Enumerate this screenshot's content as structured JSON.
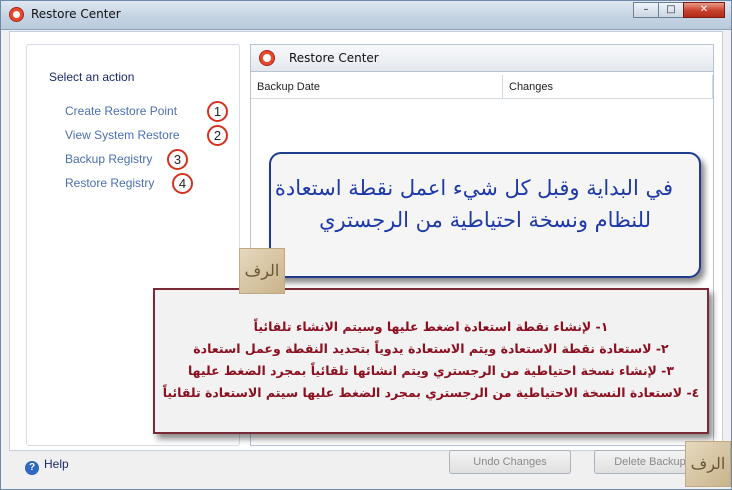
{
  "window": {
    "title": "Restore Center",
    "buttons": [
      "minimize",
      "maximize",
      "close"
    ]
  },
  "sidebar": {
    "heading": "Select an action",
    "items": [
      {
        "label": "Create Restore Point",
        "number": "1"
      },
      {
        "label": "View System Restore",
        "number": "2"
      },
      {
        "label": "Backup Registry",
        "number": "3"
      },
      {
        "label": "Restore Registry",
        "number": "4"
      }
    ]
  },
  "panel": {
    "title": "Restore Center",
    "columns": [
      "Backup Date",
      "Changes"
    ]
  },
  "footer": {
    "help_label": "Help",
    "undo_button": "Undo Changes",
    "delete_button": "Delete Backup"
  },
  "annotations": {
    "blue_lines": [
      "في البداية وقبل كل شيء اعمل نقطة استعادة",
      "للنظام ونسخة احتياطية من الرجستري"
    ],
    "red_lines": [
      "١- لإنشاء نقطة استعادة اضغط عليها وسيتم الانشاء تلقائياً",
      "٢- لاستعادة نقطة الاستعادة ويتم الاستعادة يدوياً بتحديد النقطة وعمل استعادة",
      "٣- لإنشاء نسخة احتياطية من الرجستري ويتم انشائها تلقائياً بمجرد الضغط عليها",
      "٤- لاستعادة النسخة الاحتياطية من الرجستري بمجرد الضغط عليها سيتم الاستعادة تلقائياً"
    ]
  },
  "colors": {
    "accent": "#4a6fb2",
    "number_ring": "#d6301f",
    "annotation_blue": "#1e3aa8",
    "annotation_red": "#8b1020"
  }
}
